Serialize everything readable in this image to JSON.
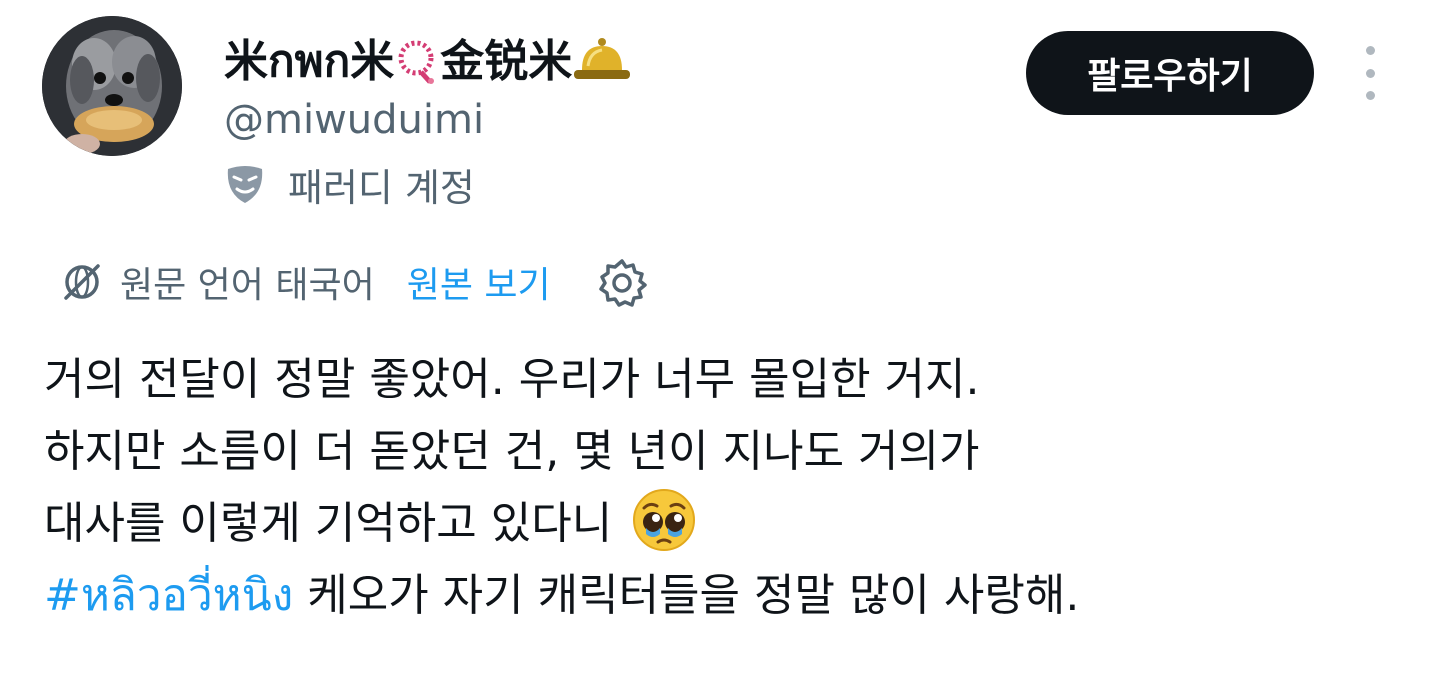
{
  "author": {
    "display_name_start": "米กพก米",
    "display_name_mid": "金锐米",
    "handle": "@miwuduimi",
    "parody_label": "패러디 계정",
    "follow_label": "팔로우하기",
    "icons": {
      "avatar": "dog-photo-avatar",
      "name_emoji_1": "prayer-beads-icon",
      "name_emoji_2": "bell-icon",
      "parody": "theater-mask-icon",
      "more": "more-vertical-icon"
    }
  },
  "translation": {
    "label": "원문 언어 태국어",
    "show_original": "원본 보기",
    "icons": {
      "indicator": "translate-globe-icon",
      "settings": "gear-icon"
    }
  },
  "tweet": {
    "line1": "거의 전달이 정말 좋았어. 우리가 너무 몰입한 거지.",
    "line2": "하지만 소름이 더 돋았던 건, 몇 년이 지나도 거의가",
    "line3": "대사를 이렇게 기억하고 있다니",
    "line3_emoji": "pleading-face-icon",
    "hashtag": "#หลิวอวี่หนิง",
    "line4_rest": " 케오가 자기 캐릭터들을 정말 많이 사랑해."
  },
  "colors": {
    "text": "#0f1419",
    "secondary_text": "#536471",
    "link": "#1d9bf0",
    "button_bg": "#0f1419",
    "button_text": "#ffffff",
    "background": "#ffffff"
  }
}
